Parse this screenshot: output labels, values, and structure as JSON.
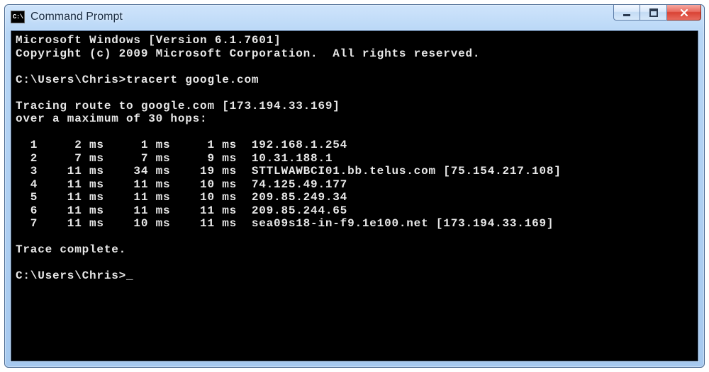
{
  "window": {
    "title": "Command Prompt",
    "icon_label": "C:\\"
  },
  "terminal": {
    "header_line1": "Microsoft Windows [Version 6.1.7601]",
    "header_line2": "Copyright (c) 2009 Microsoft Corporation.  All rights reserved.",
    "prompt_path": "C:\\Users\\Chris>",
    "command": "tracert google.com",
    "trace_header1": "Tracing route to google.com [173.194.33.169]",
    "trace_header2": "over a maximum of 30 hops:",
    "hops": [
      {
        "n": 1,
        "t1": "2 ms",
        "t2": "1 ms",
        "t3": "1 ms",
        "host": "192.168.1.254"
      },
      {
        "n": 2,
        "t1": "7 ms",
        "t2": "7 ms",
        "t3": "9 ms",
        "host": "10.31.188.1"
      },
      {
        "n": 3,
        "t1": "11 ms",
        "t2": "34 ms",
        "t3": "19 ms",
        "host": "STTLWAWBCI01.bb.telus.com [75.154.217.108]"
      },
      {
        "n": 4,
        "t1": "11 ms",
        "t2": "11 ms",
        "t3": "10 ms",
        "host": "74.125.49.177"
      },
      {
        "n": 5,
        "t1": "11 ms",
        "t2": "11 ms",
        "t3": "10 ms",
        "host": "209.85.249.34"
      },
      {
        "n": 6,
        "t1": "11 ms",
        "t2": "11 ms",
        "t3": "11 ms",
        "host": "209.85.244.65"
      },
      {
        "n": 7,
        "t1": "11 ms",
        "t2": "10 ms",
        "t3": "11 ms",
        "host": "sea09s18-in-f9.1e100.net [173.194.33.169]"
      }
    ],
    "trace_footer": "Trace complete.",
    "cursor": "_"
  }
}
